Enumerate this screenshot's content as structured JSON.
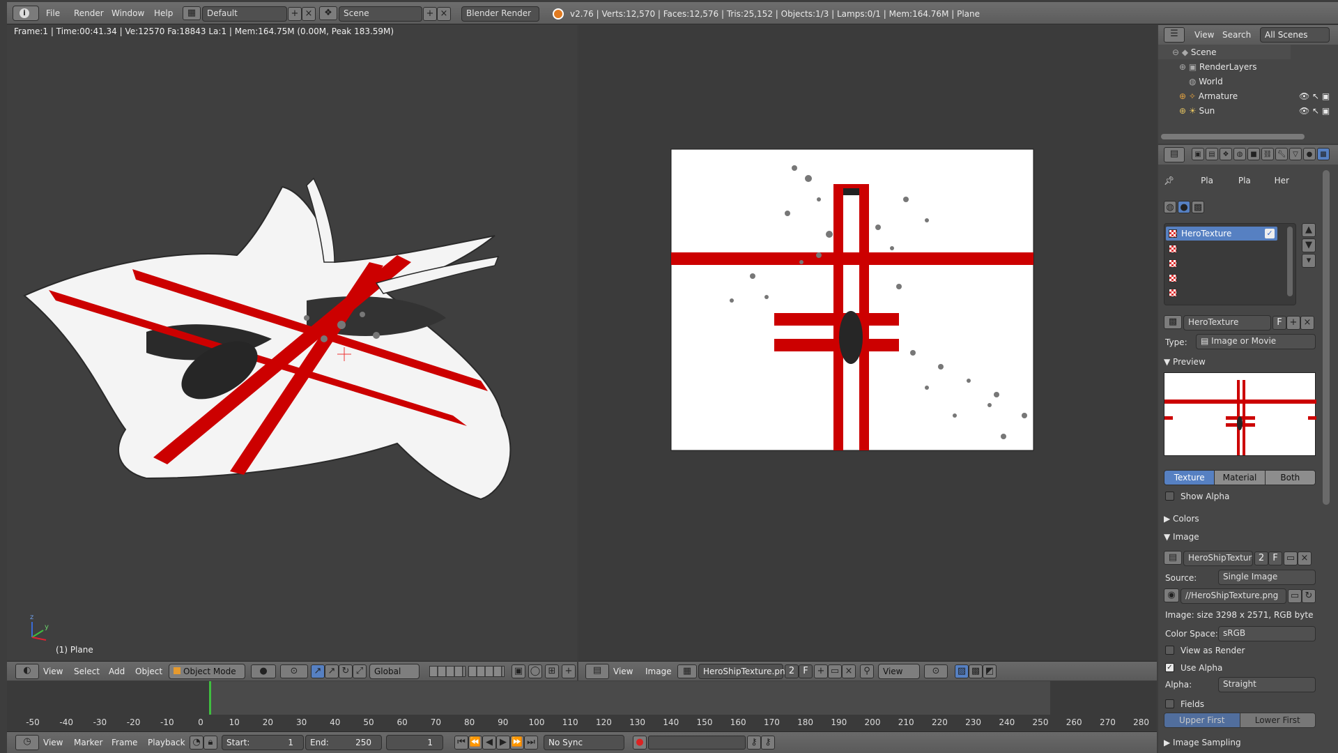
{
  "topbar": {
    "menus": [
      "File",
      "Render",
      "Window",
      "Help"
    ],
    "screen_layout": "Default",
    "scene": "Scene",
    "render_engine": "Blender Render",
    "stats": "v2.76 | Verts:12,570 | Faces:12,576 | Tris:25,152 | Objects:1/3 | Lamps:0/1 | Mem:164.76M | Plane"
  },
  "viewport": {
    "info": "Frame:1 | Time:00:41.34 | Ve:12570 Fa:18843 La:1 | Mem:164.75M (0.00M, Peak 183.59M)",
    "object": "(1) Plane",
    "axes": {
      "z": "z",
      "y": "y"
    }
  },
  "view3d_header": {
    "menus": [
      "View",
      "Select",
      "Add",
      "Object"
    ],
    "mode": "Object Mode",
    "orientation": "Global"
  },
  "image_header": {
    "menus": [
      "View",
      "Image"
    ],
    "image": "HeroShipTexture.png",
    "users": "2",
    "fake": "F",
    "view": "View"
  },
  "timeline": {
    "ticks": [
      "-50",
      "-40",
      "-30",
      "-20",
      "-10",
      "0",
      "10",
      "20",
      "30",
      "40",
      "50",
      "60",
      "70",
      "80",
      "90",
      "100",
      "110",
      "120",
      "130",
      "140",
      "150",
      "160",
      "170",
      "180",
      "190",
      "200",
      "210",
      "220",
      "230",
      "240",
      "250",
      "260",
      "270",
      "280"
    ],
    "menus": [
      "View",
      "Marker",
      "Frame",
      "Playback"
    ],
    "start_label": "Start:",
    "start": "1",
    "end_label": "End:",
    "end": "250",
    "current": "1",
    "sync": "No Sync"
  },
  "outliner": {
    "menus": [
      "View",
      "Search"
    ],
    "filter": "All Scenes",
    "items": [
      "Scene",
      "RenderLayers",
      "World",
      "Armature",
      "Sun"
    ]
  },
  "properties": {
    "breadcrumb": [
      "Pla",
      "Pla",
      "Her"
    ],
    "texture_slot": "HeroTexture",
    "texture_name": "HeroTexture",
    "texture_fake": "F",
    "type_label": "Type:",
    "type": "Image or Movie",
    "preview_label": "Preview",
    "preview_tabs": [
      "Texture",
      "Material",
      "Both"
    ],
    "show_alpha": "Show Alpha",
    "colors_label": "Colors",
    "image_label": "Image",
    "image_name": "HeroShipTexture...",
    "image_users": "2",
    "image_fake": "F",
    "source_label": "Source:",
    "source": "Single Image",
    "filepath": "//HeroShipTexture.png",
    "image_info": "Image: size 3298 x 2571, RGB byte",
    "colorspace_label": "Color Space:",
    "colorspace": "sRGB",
    "view_as_render": "View as Render",
    "use_alpha": "Use Alpha",
    "alpha_label": "Alpha:",
    "alpha": "Straight",
    "fields": "Fields",
    "field_order": [
      "Upper First",
      "Lower First"
    ],
    "sampling_label": "Image Sampling"
  }
}
